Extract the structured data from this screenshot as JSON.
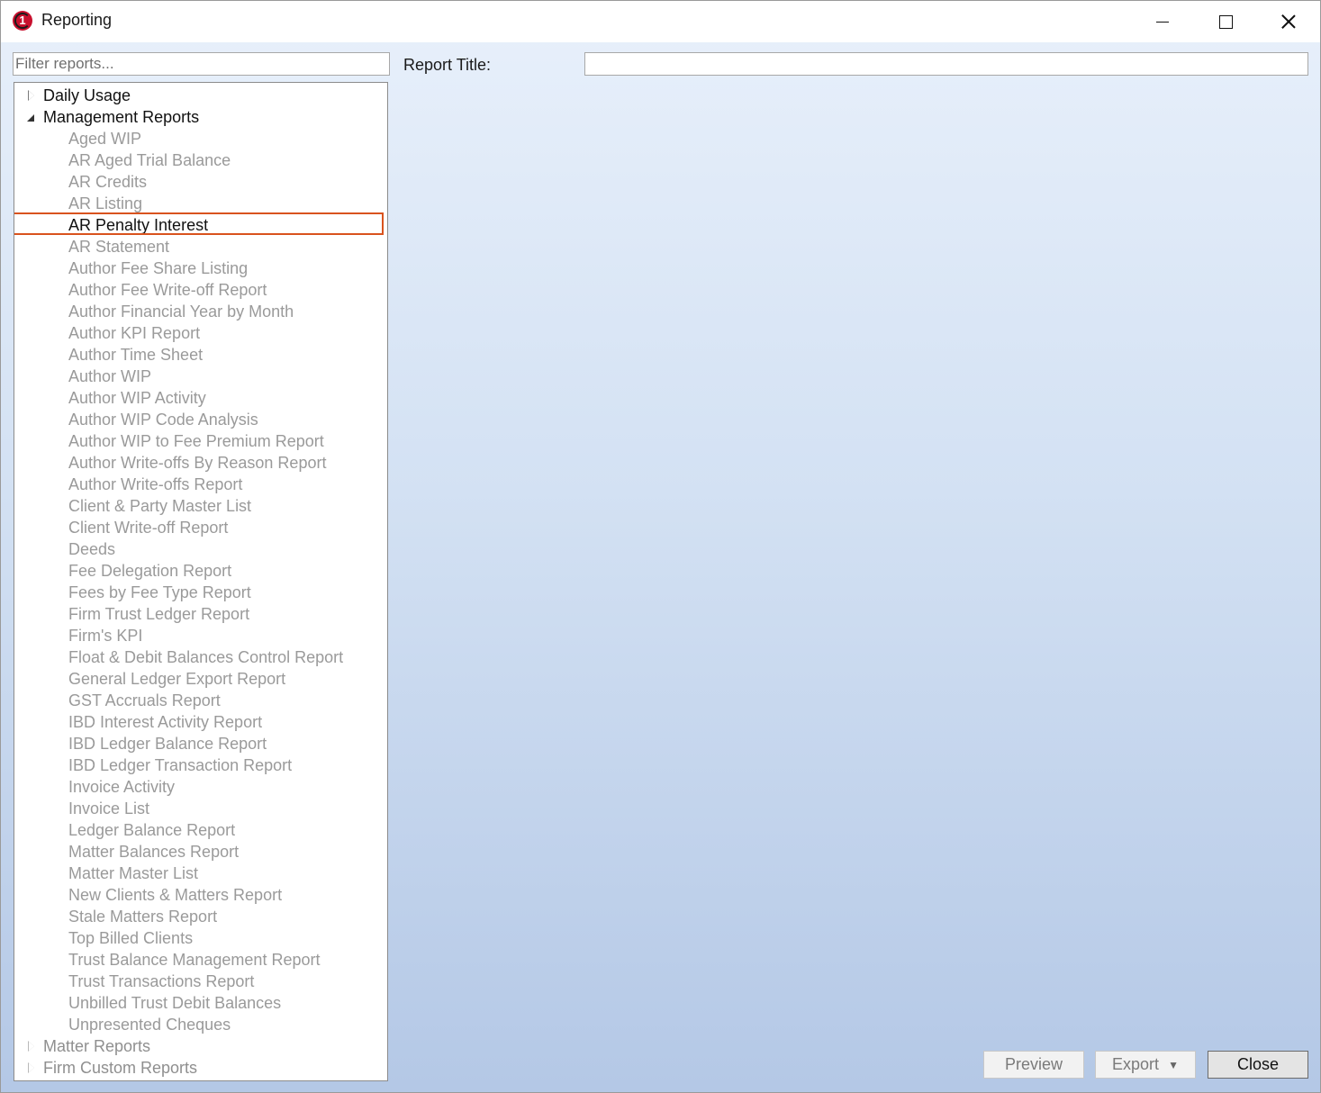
{
  "window": {
    "title": "Reporting",
    "minimize_icon": "minimize-icon",
    "maximize_icon": "maximize-icon",
    "close_icon": "close-icon"
  },
  "filter": {
    "placeholder": "Filter reports...",
    "value": ""
  },
  "report_title": {
    "label": "Report Title:",
    "value": ""
  },
  "tree": {
    "groups": [
      {
        "label": "Daily Usage",
        "expanded": false
      },
      {
        "label": "Management Reports",
        "expanded": true
      },
      {
        "label": "Matter Reports",
        "expanded": false
      },
      {
        "label": "Firm Custom Reports",
        "expanded": false
      }
    ],
    "management_items": [
      "Aged WIP",
      "AR Aged Trial Balance",
      "AR Credits",
      "AR Listing",
      "AR Penalty Interest",
      "AR Statement",
      "Author Fee Share Listing",
      "Author Fee Write-off Report",
      "Author Financial Year by Month",
      "Author KPI Report",
      "Author Time Sheet",
      "Author WIP",
      "Author WIP Activity",
      "Author WIP Code Analysis",
      "Author WIP to Fee Premium Report",
      "Author Write-offs By Reason Report",
      "Author Write-offs Report",
      "Client & Party Master List",
      "Client Write-off Report",
      "Deeds",
      "Fee Delegation Report",
      "Fees by Fee Type Report",
      "Firm Trust Ledger Report",
      "Firm's KPI",
      "Float & Debit Balances Control Report",
      "General Ledger Export Report",
      "GST Accruals Report",
      "IBD Interest Activity Report",
      "IBD Ledger Balance Report",
      "IBD Ledger Transaction Report",
      "Invoice Activity",
      "Invoice List",
      "Ledger Balance Report",
      "Matter Balances Report",
      "Matter Master List",
      "New Clients & Matters Report",
      "Stale Matters Report",
      "Top Billed Clients",
      "Trust Balance Management Report",
      "Trust Transactions Report",
      "Unbilled Trust Debit Balances",
      "Unpresented Cheques"
    ],
    "selected": "AR Penalty Interest"
  },
  "buttons": {
    "preview": "Preview",
    "export": "Export",
    "export_caret": "▼",
    "close": "Close"
  },
  "colors": {
    "selection_border": "#d9531e",
    "disabled_text": "#9a9a9a"
  }
}
